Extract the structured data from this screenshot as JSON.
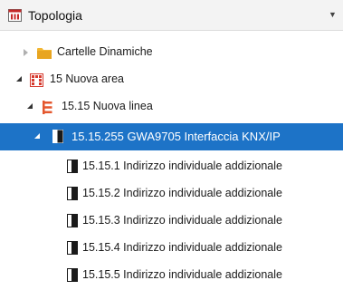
{
  "header": {
    "title": "Topologia",
    "icon": "topology-icon",
    "dropdown_icon": "chevron-down-icon"
  },
  "tree": [
    {
      "label": "Cartelle Dinamiche",
      "icon": "folder-icon",
      "state": "collapsed"
    },
    {
      "label": "15 Nuova area",
      "icon": "area-icon",
      "state": "expanded"
    },
    {
      "label": "15.15 Nuova linea",
      "icon": "line-icon",
      "state": "expanded"
    },
    {
      "label": "15.15.255 GWA9705 Interfaccia KNX/IP",
      "icon": "device-icon",
      "state": "expanded",
      "selected": true
    },
    {
      "label": "15.15.1 Indirizzo individuale addizionale",
      "icon": "device-icon"
    },
    {
      "label": "15.15.2 Indirizzo individuale addizionale",
      "icon": "device-icon"
    },
    {
      "label": "15.15.3 Indirizzo individuale addizionale",
      "icon": "device-icon"
    },
    {
      "label": "15.15.4 Indirizzo individuale addizionale",
      "icon": "device-icon"
    },
    {
      "label": "15.15.5 Indirizzo individuale addizionale",
      "icon": "device-icon"
    }
  ],
  "colors": {
    "selection": "#1d73c7",
    "folder": "#f2b632",
    "area": "#d63a2e",
    "line": "#e4572e"
  }
}
